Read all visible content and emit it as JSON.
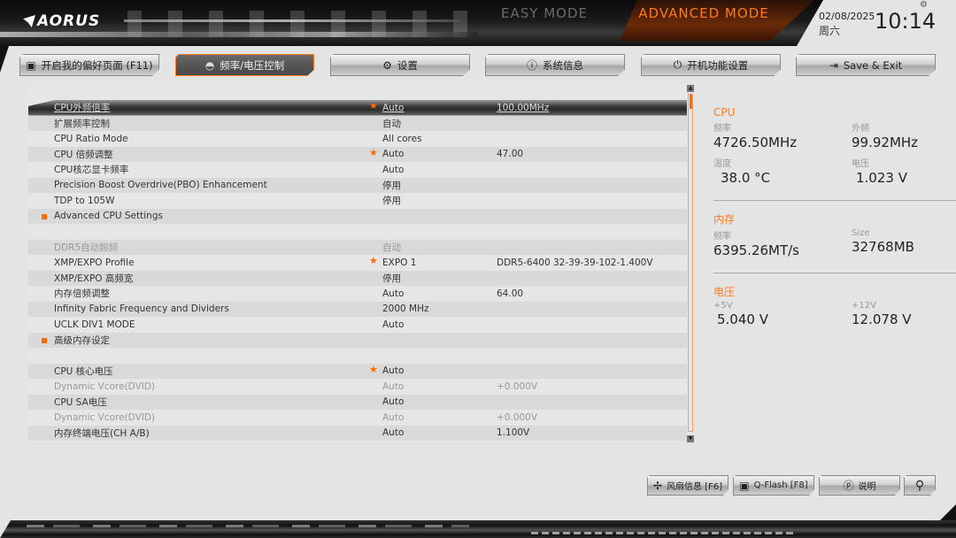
{
  "header": {
    "logo_text": "AORUS",
    "mode_easy": "EASY MODE",
    "mode_advanced": "ADVANCED MODE",
    "date": "02/08/2025",
    "weekday": "周六",
    "time": "10:14",
    "settings_icon": "gear-icon"
  },
  "nav": {
    "tabs": [
      {
        "label": "开启我的偏好页面 (F11)",
        "icon": "star-folder-icon",
        "active": false
      },
      {
        "label": "频率/电压控制",
        "icon": "gauge-icon",
        "active": true
      },
      {
        "label": "设置",
        "icon": "gear-icon",
        "active": false
      },
      {
        "label": "系统信息",
        "icon": "info-icon",
        "active": false
      },
      {
        "label": "开机功能设置",
        "icon": "power-icon",
        "active": false
      },
      {
        "label": "Save & Exit",
        "icon": "exit-icon",
        "active": false
      }
    ]
  },
  "settings": {
    "rows": [
      {
        "label": "CPU外频倍率",
        "star": true,
        "value": "Auto",
        "value2": "100.00MHz",
        "selected": true
      },
      {
        "label": "扩展频率控制",
        "value": "自动"
      },
      {
        "label": "CPU Ratio Mode",
        "value": "All cores"
      },
      {
        "label": "CPU 倍频调整",
        "star": true,
        "value": "Auto",
        "value2": "47.00"
      },
      {
        "label": "CPU核芯显卡频率",
        "value": "Auto"
      },
      {
        "label": "Precision Boost Overdrive(PBO) Enhancement",
        "value": "停用"
      },
      {
        "label": "TDP to 105W",
        "value": "停用"
      },
      {
        "label": "Advanced CPU Settings",
        "bullet": true
      },
      {
        "label": ""
      },
      {
        "label": "DDR5自动超频",
        "value": "自动",
        "dim": true
      },
      {
        "label": "XMP/EXPO Profile",
        "star": true,
        "value": "EXPO 1",
        "value2": "DDR5-6400 32-39-39-102-1.400V"
      },
      {
        "label": "XMP/EXPO 高频宽",
        "value": "停用"
      },
      {
        "label": "内存倍频调整",
        "value": "Auto",
        "value2": "64.00"
      },
      {
        "label": "Infinity Fabric Frequency and Dividers",
        "value": "2000 MHz"
      },
      {
        "label": "UCLK DIV1 MODE",
        "value": "Auto"
      },
      {
        "label": "高级内存设定",
        "bullet": true
      },
      {
        "label": ""
      },
      {
        "label": "CPU 核心电压",
        "star": true,
        "value": "Auto"
      },
      {
        "label": "Dynamic Vcore(DVID)",
        "value": "Auto",
        "value2": "+0.000V",
        "dim": true
      },
      {
        "label": "CPU SA电压",
        "value": "Auto"
      },
      {
        "label": "Dynamic Vcore(DVID)",
        "value": "Auto",
        "value2": "+0.000V",
        "dim": true
      },
      {
        "label": "内存终端电压(CH A/B)",
        "value": "Auto",
        "value2": "1.100V"
      }
    ],
    "scroll_position": 0.0
  },
  "info": {
    "cpu": {
      "title": "CPU",
      "freq_label": "频率",
      "freq_value": "4726.50MHz",
      "bclk_label": "外频",
      "bclk_value": "99.92MHz",
      "temp_label": "温度",
      "temp_value": "38.0 °C",
      "volt_label": "电压",
      "volt_value": "1.023 V"
    },
    "memory": {
      "title": "内存",
      "freq_label": "频率",
      "freq_value": "6395.26MT/s",
      "size_label": "Size",
      "size_value": "32768MB"
    },
    "voltage": {
      "title": "电压",
      "v5_label": "+5V",
      "v5_value": "5.040 V",
      "v12_label": "+12V",
      "v12_value": "12.078 V"
    }
  },
  "bottom_buttons": [
    {
      "label": "风扇信息 [F6]",
      "icon": "fan-icon"
    },
    {
      "label": "Q-Flash [F8]",
      "icon": "chip-icon"
    },
    {
      "label": "说明",
      "icon": "help-icon"
    },
    {
      "label": "",
      "icon": "search-icon"
    }
  ],
  "colors": {
    "accent": "#ff6a00",
    "accent_text": "#ff7a1a"
  }
}
